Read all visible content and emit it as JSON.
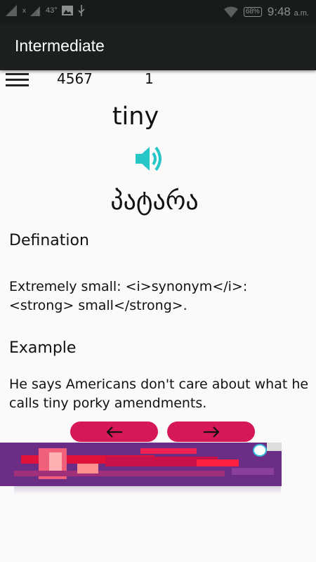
{
  "status_bar": {
    "signal_indicator": "x",
    "temperature": "43°",
    "battery": "68%",
    "time": "9:48",
    "ampm": "a.m."
  },
  "app_bar": {
    "title": "Intermediate"
  },
  "counters": {
    "total": "4567",
    "current": "1"
  },
  "card": {
    "word": "tiny",
    "translation": "პატარა",
    "definition_heading": "Defination",
    "definition": "Extremely small: <i>synonym</i>: <strong> small</strong>.",
    "example_heading": "Example",
    "example": "He says Americans don't care about what he calls tiny porky amendments."
  },
  "nav": {
    "prev_icon": "arrow-left-icon",
    "next_icon": "arrow-right-icon",
    "button_color": "#d6175a"
  },
  "colors": {
    "speaker": "#26c6c6",
    "app_bar": "#1b201e",
    "ad_bg": "#6c2d87"
  }
}
